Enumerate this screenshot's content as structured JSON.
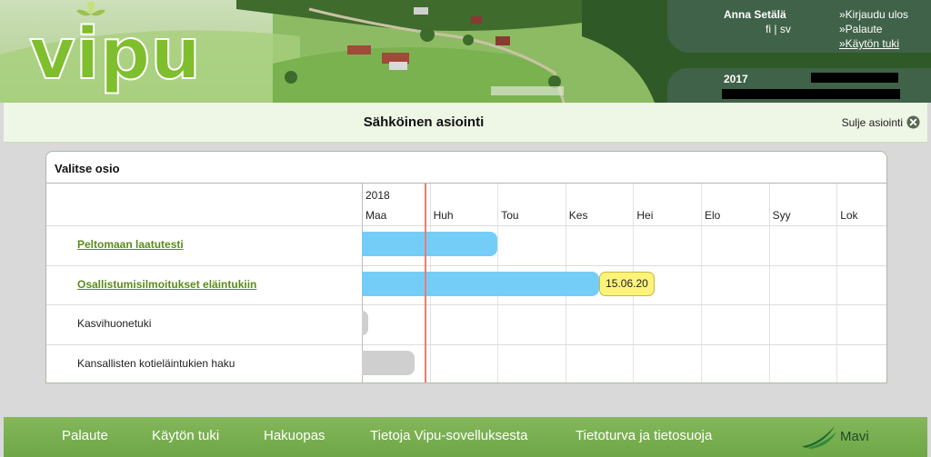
{
  "header": {
    "logo_text": "vipu",
    "user_name": "Anna Setälä",
    "languages": [
      "fi",
      "sv"
    ],
    "lang_separator": "|",
    "links": [
      "»Kirjaudu ulos",
      "»Palaute",
      "»Käytön tuki"
    ],
    "year": "2017"
  },
  "titlebar": {
    "title": "Sähköinen asiointi",
    "close_label": "Sulje asiointi"
  },
  "panel": {
    "title": "Valitse osio",
    "year": "2018",
    "months": [
      "Maa",
      "Huh",
      "Tou",
      "Kes",
      "Hei",
      "Elo",
      "Syy",
      "Lok"
    ],
    "rows": [
      {
        "label": "Peltomaan laatutesti",
        "link": true,
        "bar_color": "blue",
        "bar_end_month": 2.0
      },
      {
        "label": "Osallistumisilmoitukset eläintukiin",
        "link": true,
        "bar_color": "blue",
        "bar_end_month": 3.5,
        "deadline": "15.06.20"
      },
      {
        "label": "Kasvihuonetuki",
        "link": false,
        "bar_color": "grey",
        "bar_end_month": 0.1
      },
      {
        "label": "Kansallisten kotieläintukien haku",
        "link": false,
        "bar_color": "grey",
        "bar_end_month": 0.78
      }
    ],
    "today_month": 0.93
  },
  "footer": {
    "links": [
      "Palaute",
      "Käytön tuki",
      "Hakuopas",
      "Tietoja Vipu-sovelluksesta",
      "Tietoturva ja tietosuoja"
    ],
    "logo_text": "Mavi"
  },
  "colors": {
    "link_green": "#5c8b1a",
    "bar_blue": "#74cdf7",
    "bar_grey": "#cfcfcf",
    "today_red": "#e87f6e",
    "deadline_yellow": "#fdf37a",
    "header_dark_green": "#3f6248",
    "footer_green": "#7ab050"
  }
}
